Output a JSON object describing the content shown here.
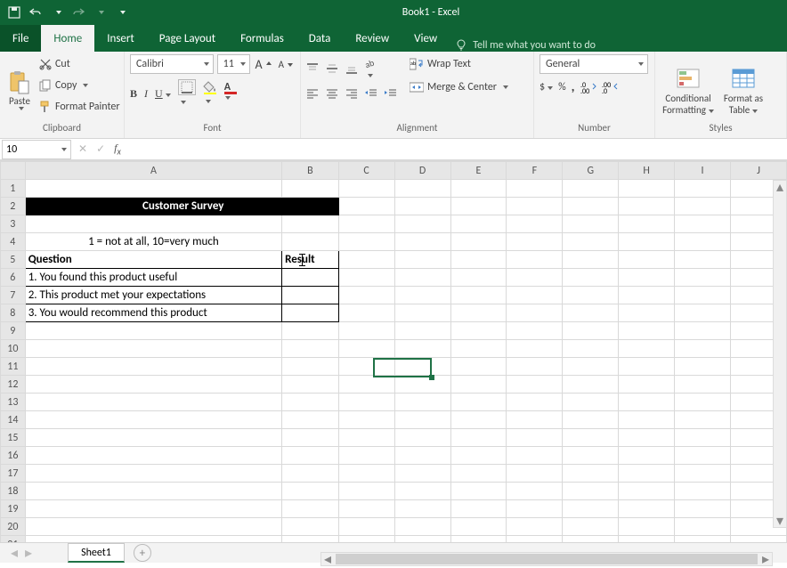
{
  "app": {
    "title": "Book1  -  Excel"
  },
  "tabs": {
    "file": "File",
    "items": [
      "Home",
      "Insert",
      "Page Layout",
      "Formulas",
      "Data",
      "Review",
      "View"
    ],
    "active": "Home",
    "tellme": "Tell me what you want to do"
  },
  "ribbon": {
    "clipboard": {
      "cut": "Cut",
      "copy": "Copy",
      "painter": "Format Painter",
      "label": "Clipboard",
      "paste": "Paste"
    },
    "font": {
      "family": "Calibri",
      "size": "11",
      "label": "Font"
    },
    "alignment": {
      "wrap": "Wrap Text",
      "merge": "Merge & Center",
      "label": "Alignment"
    },
    "number": {
      "format": "General",
      "label": "Number"
    },
    "styles": {
      "cond": "Conditional",
      "cond2": "Formatting",
      "fas": "Format as",
      "fas2": "Table",
      "label": "Styles"
    }
  },
  "fmla": {
    "namebox": "10",
    "value": ""
  },
  "columns": [
    "A",
    "B",
    "C",
    "D",
    "E",
    "F",
    "G",
    "H",
    "I",
    "J"
  ],
  "rows_visible": 21,
  "sheet": {
    "A2B2": "Customer Survey",
    "A4": "1 = not at all, 10=very much",
    "A5": "Question",
    "B5": "Result",
    "A6": "1. You found this product useful",
    "A7": "2. This product met your expectations",
    "A8": "3. You would recommend this product"
  },
  "tabs_sheet": {
    "name": "Sheet1"
  },
  "active_cell": "D11"
}
